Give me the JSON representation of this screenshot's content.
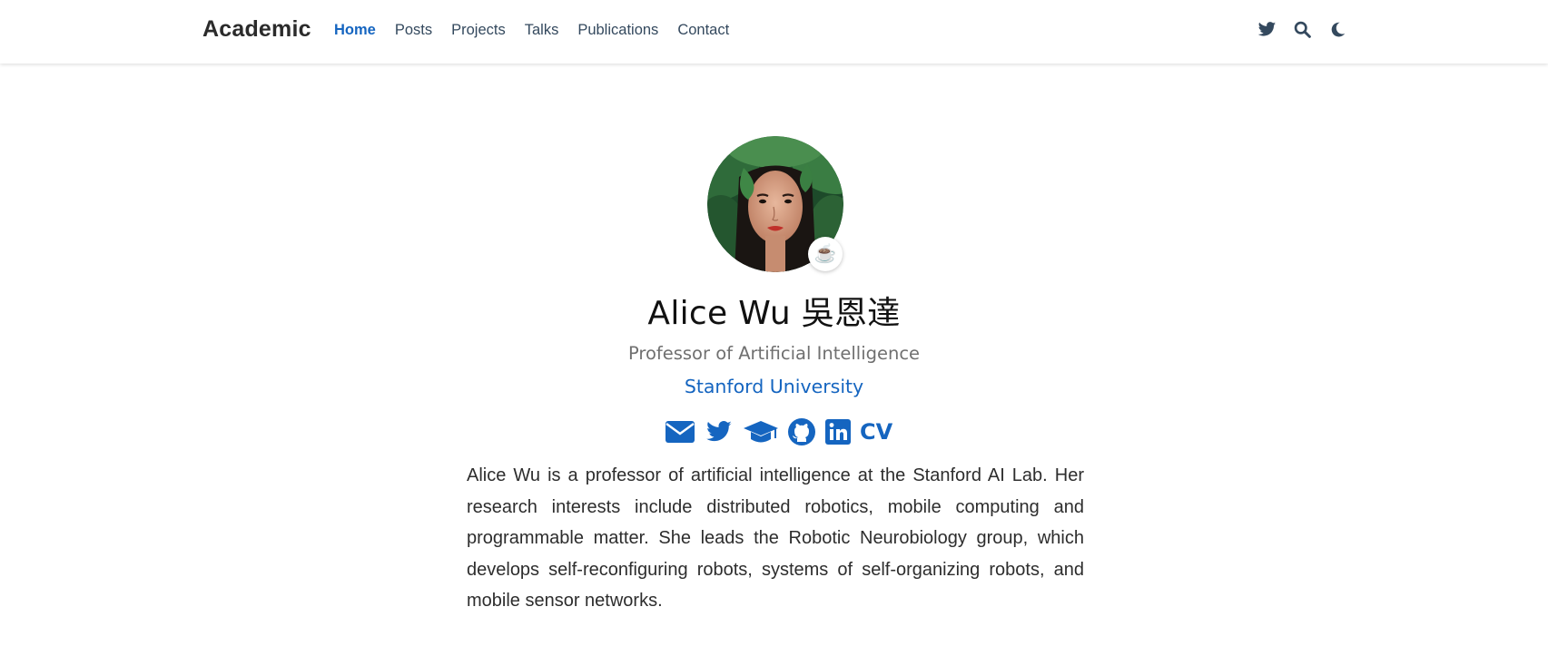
{
  "navbar": {
    "brand": "Academic",
    "links": [
      {
        "label": "Home",
        "active": true
      },
      {
        "label": "Posts",
        "active": false
      },
      {
        "label": "Projects",
        "active": false
      },
      {
        "label": "Talks",
        "active": false
      },
      {
        "label": "Publications",
        "active": false
      },
      {
        "label": "Contact",
        "active": false
      }
    ],
    "icons": [
      "twitter-icon",
      "search-icon",
      "moon-icon"
    ]
  },
  "profile": {
    "name": "Alice Wu 吳恩達",
    "role": "Professor of Artificial Intelligence",
    "organization": "Stanford University",
    "status_emoji": "☕",
    "social_icons": [
      "envelope-icon",
      "twitter-icon",
      "graduation-cap-icon",
      "github-icon",
      "linkedin-icon"
    ],
    "cv_label": "CV",
    "bio": "Alice Wu is a professor of artificial intelligence at the Stanford AI Lab. Her research interests include distributed robotics, mobile computing and programmable matter. She leads the Robotic Neurobiology group, which develops self-reconfiguring robots, systems of self-organizing robots, and mobile sensor networks."
  },
  "colors": {
    "accent": "#1565c0",
    "nav_text": "#34495e",
    "subtitle": "#707070"
  }
}
